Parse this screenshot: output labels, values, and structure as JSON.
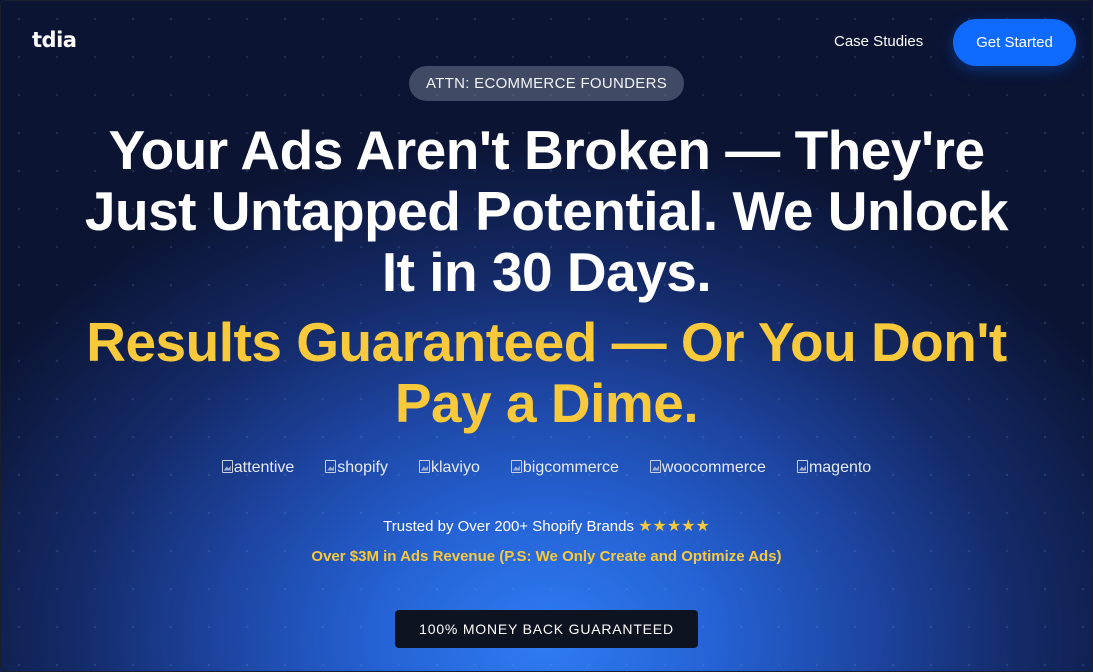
{
  "header": {
    "logo": "tdia",
    "nav_link": "Case Studies",
    "cta": "Get Started"
  },
  "hero": {
    "badge": "ATTN: ECOMMERCE FOUNDERS",
    "headline_line1": "Your Ads Aren't Broken — They're",
    "headline_line2": "Just Untapped Potential. We Unlock",
    "headline_line3": "It in 30 Days.",
    "subheadline_line1": "Results Guaranteed — Or You Don't",
    "subheadline_line2": "Pay a Dime.",
    "partner_logos": [
      "attentive",
      "shopify",
      "klaviyo",
      "bigcommerce",
      "woocommerce",
      "magento"
    ],
    "trusted_text": "Trusted by Over 200+ Shopify Brands",
    "stars": "★★★★★",
    "revenue_text": "Over $3M in Ads Revenue (P.S: We Only Create and Optimize Ads)",
    "guarantee_label": "100% MONEY BACK GUARANTEED"
  },
  "colors": {
    "accent_blue": "#0f6bff",
    "accent_yellow": "#f8c93a",
    "badge_dark": "#0e1322"
  },
  "icons": {
    "stars": "star-icon",
    "partner_logo": "broken-image-icon"
  }
}
